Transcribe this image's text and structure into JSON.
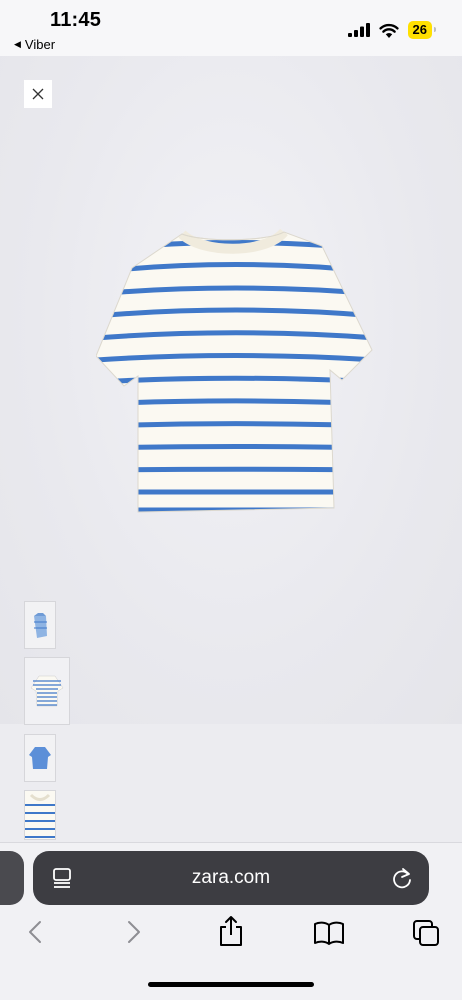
{
  "status_bar": {
    "time": "11:45",
    "back_app": "Viber",
    "battery": "26",
    "icons": [
      "signal-icon",
      "wifi-icon",
      "battery-icon"
    ]
  },
  "product": {
    "close_icon": "close-icon",
    "stripe_color": "#3f78c9",
    "shirt_color": "#fbf9f2"
  },
  "thumbnails": [
    {
      "name": "thumb-folded-shirt"
    },
    {
      "name": "thumb-striped-shirt-front"
    },
    {
      "name": "thumb-blue-shirt"
    },
    {
      "name": "thumb-striped-shirt-detail"
    }
  ],
  "browser": {
    "url": "zara.com",
    "toolbar": [
      "back-icon",
      "forward-icon",
      "share-icon",
      "bookmarks-icon",
      "tabs-icon"
    ]
  }
}
